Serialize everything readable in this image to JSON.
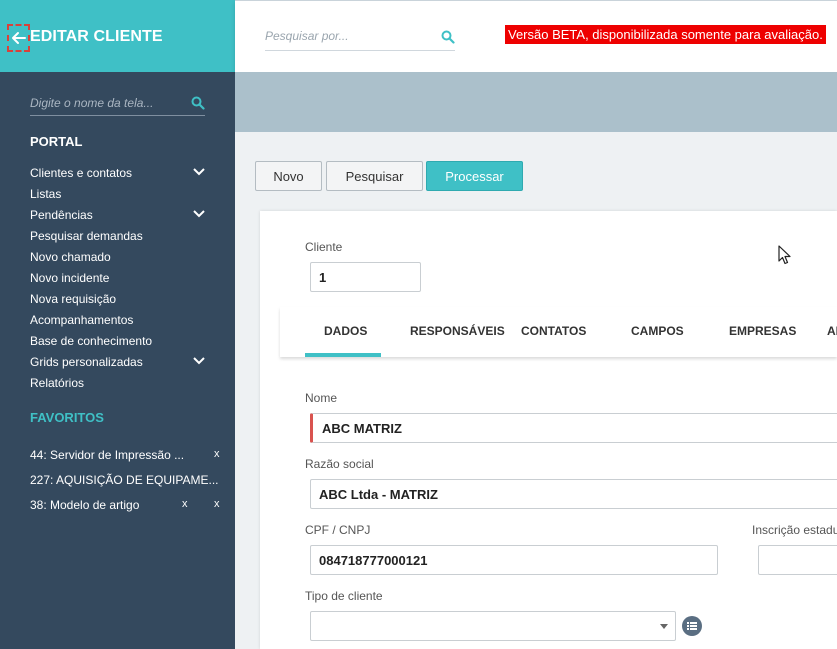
{
  "sidebar": {
    "title": "EDITAR CLIENTE",
    "search_placeholder": "Digite o nome da tela...",
    "portal_title": "PORTAL",
    "items": [
      {
        "label": "Clientes e contatos",
        "expandable": true
      },
      {
        "label": "Listas",
        "expandable": false
      },
      {
        "label": "Pendências",
        "expandable": true
      },
      {
        "label": "Pesquisar demandas",
        "expandable": false
      },
      {
        "label": "Novo chamado",
        "expandable": false
      },
      {
        "label": "Novo incidente",
        "expandable": false
      },
      {
        "label": "Nova requisição",
        "expandable": false
      },
      {
        "label": "Acompanhamentos",
        "expandable": false
      },
      {
        "label": "Base de conhecimento",
        "expandable": false
      },
      {
        "label": "Grids personalizadas",
        "expandable": true
      },
      {
        "label": "Relatórios",
        "expandable": false
      }
    ],
    "favorites_title": "FAVORITOS",
    "favorites": [
      {
        "label": "44: Servidor de Impressão ...",
        "close": "x"
      },
      {
        "label": "227: AQUISIÇÃO DE EQUIPAME...",
        "close": ""
      },
      {
        "label": "38: Modelo de artigo",
        "close": "x",
        "close2": "x"
      }
    ]
  },
  "topbar": {
    "search_placeholder": "Pesquisar por...",
    "beta_notice": "Versão BETA, disponibilizada somente para avaliação."
  },
  "toolbar": {
    "novo_label": "Novo",
    "pesquisar_label": "Pesquisar",
    "processar_label": "Processar"
  },
  "form": {
    "cliente_label": "Cliente",
    "cliente_value": "1",
    "tabs": [
      "DADOS",
      "RESPONSÁVEIS",
      "CONTATOS",
      "CAMPOS",
      "EMPRESAS",
      "AI"
    ],
    "active_tab": "DADOS",
    "nome_label": "Nome",
    "nome_value": "ABC MATRIZ",
    "razao_label": "Razão social",
    "razao_value": "ABC Ltda - MATRIZ",
    "cpf_label": "CPF / CNPJ",
    "cpf_value": "084718777000121",
    "inscricao_label": "Inscrição estadu",
    "tipo_label": "Tipo de cliente",
    "tipo_value": ""
  },
  "colors": {
    "accent": "#3fc0c6",
    "sidebar_bg": "#34495e",
    "beta_bg": "#ee0000",
    "required_marker": "#d9534f"
  }
}
